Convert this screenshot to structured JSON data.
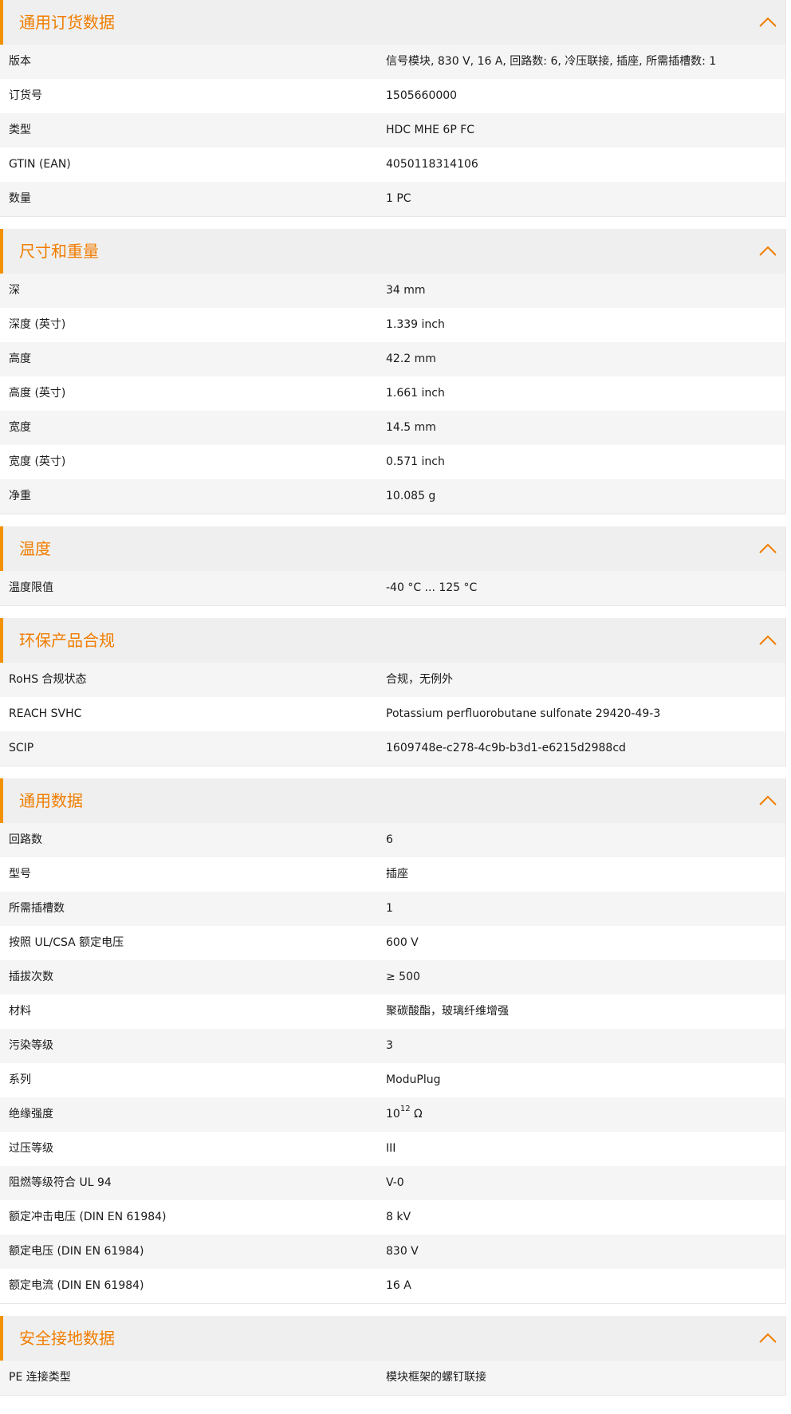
{
  "theme": {
    "accent": "#f07d00",
    "header_bg": "#efefef",
    "row_alt_bg": "#f5f5f5",
    "text": "#1a1a1a",
    "toggle_icon": "chevron-up-icon"
  },
  "sections": {
    "ordering": {
      "title": "通用订货数据",
      "rows": {
        "version": {
          "label": "版本",
          "value": "信号模块, 830 V, 16 A, 回路数: 6, 冷压联接, 插座, 所需插槽数: 1"
        },
        "order_no": {
          "label": "订货号",
          "value": "1505660000"
        },
        "type": {
          "label": "类型",
          "value": "HDC MHE 6P FC"
        },
        "gtin": {
          "label": "GTIN (EAN)",
          "value": "4050118314106"
        },
        "qty": {
          "label": "数量",
          "value": "1  PC"
        }
      }
    },
    "dimensions": {
      "title": "尺寸和重量",
      "rows": {
        "depth": {
          "label": "深",
          "value": "34  mm"
        },
        "depth_in": {
          "label": "深度 (英寸)",
          "value": "1.339  inch"
        },
        "height": {
          "label": "高度",
          "value": "42.2  mm"
        },
        "height_in": {
          "label": "高度 (英寸)",
          "value": "1.661  inch"
        },
        "width": {
          "label": "宽度",
          "value": "14.5  mm"
        },
        "width_in": {
          "label": "宽度 (英寸)",
          "value": "0.571  inch"
        },
        "net_weight": {
          "label": "净重",
          "value": "10.085  g"
        }
      }
    },
    "temperature": {
      "title": "温度",
      "rows": {
        "limit": {
          "label": "温度限值",
          "value": "-40 °C ... 125 °C"
        }
      }
    },
    "compliance": {
      "title": "环保产品合规",
      "rows": {
        "rohs": {
          "label": "RoHS 合规状态",
          "value": "合规，无例外"
        },
        "reach": {
          "label": "REACH SVHC",
          "value": "Potassium perfluorobutane sulfonate 29420-49-3"
        },
        "scip": {
          "label": "SCIP",
          "value": "1609748e-c278-4c9b-b3d1-e6215d2988cd"
        }
      }
    },
    "general": {
      "title": "通用数据",
      "rows": {
        "circuits": {
          "label": "回路数",
          "value": "6"
        },
        "model": {
          "label": "型号",
          "value": "插座"
        },
        "slots": {
          "label": "所需插槽数",
          "value": "1"
        },
        "ul_voltage": {
          "label": "按照 UL/CSA 额定电压",
          "value": "600 V"
        },
        "mating": {
          "label": "插拔次数",
          "value": "≥ 500"
        },
        "material": {
          "label": "材料",
          "value": "聚碳酸酯，玻璃纤维增强"
        },
        "pollution": {
          "label": "污染等级",
          "value": "3"
        },
        "series": {
          "label": "系列",
          "value": "ModuPlug"
        },
        "insulation": {
          "label": "绝缘强度",
          "value_base": "10",
          "value_exp": "12",
          "value_unit": " Ω"
        },
        "overvoltage": {
          "label": "过压等级",
          "value": "III"
        },
        "flammability": {
          "label": "阻燃等级符合 UL 94",
          "value": "V-0"
        },
        "impulse_voltage": {
          "label": "额定冲击电压 (DIN EN 61984)",
          "value": "8  kV"
        },
        "rated_voltage": {
          "label": "额定电压 (DIN EN 61984)",
          "value": "830  V"
        },
        "rated_current": {
          "label": "额定电流 (DIN EN 61984)",
          "value": "16  A"
        }
      }
    },
    "grounding": {
      "title": "安全接地数据",
      "rows": {
        "pe_type": {
          "label": "PE 连接类型",
          "value": "模块框架的螺钉联接"
        }
      }
    }
  }
}
